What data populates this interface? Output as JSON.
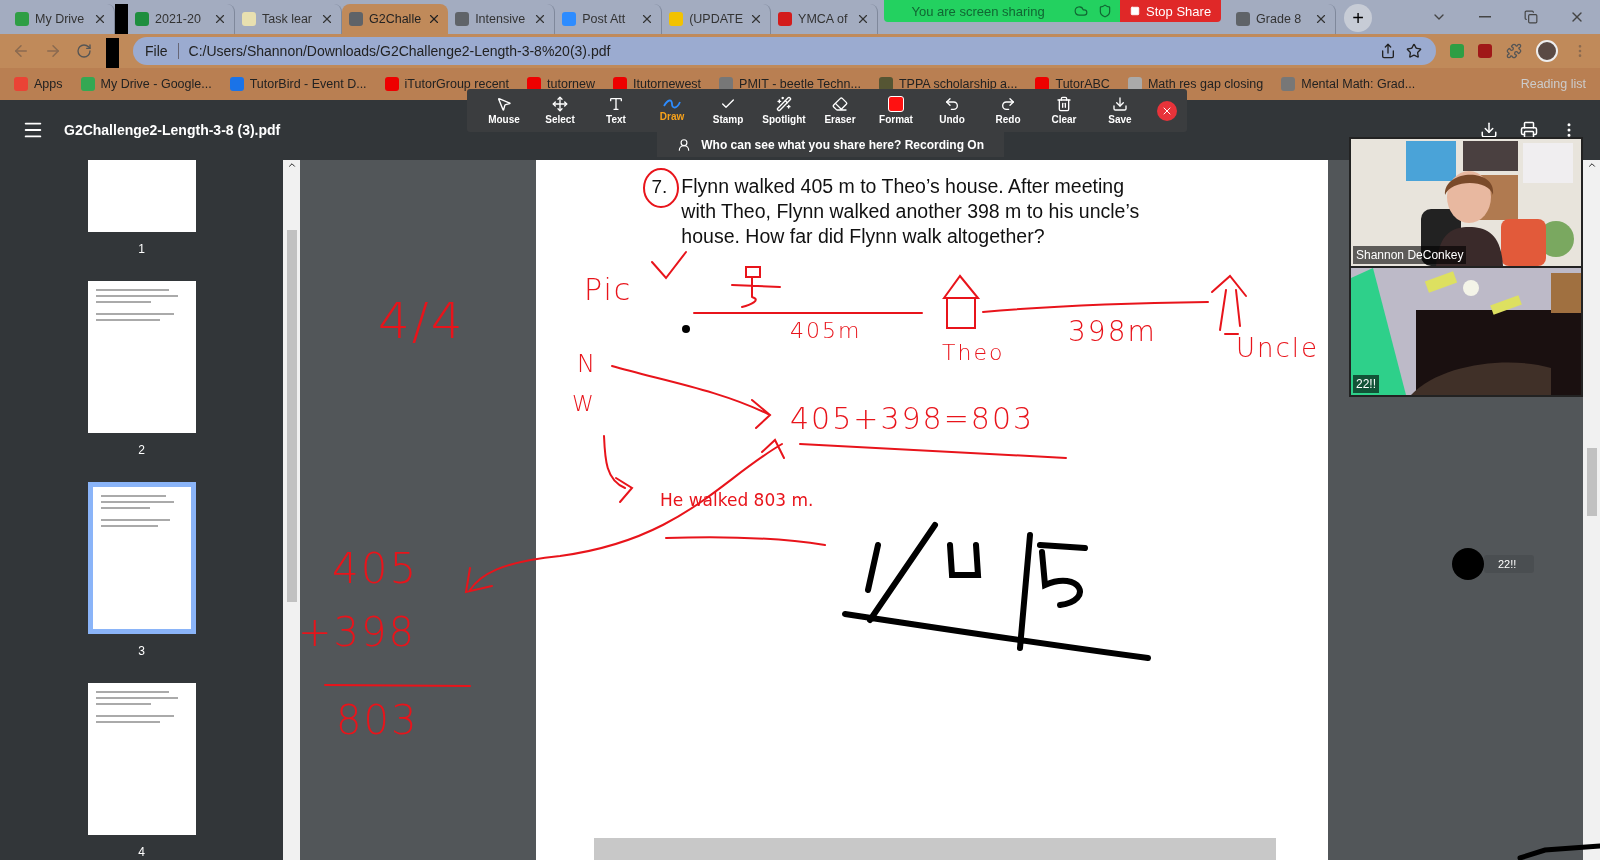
{
  "browser": {
    "tabs": [
      {
        "title": "My Drive",
        "selected": false
      },
      {
        "title": "2021-20",
        "selected": false
      },
      {
        "title": "Task lear",
        "selected": false
      },
      {
        "title": "G2Challe",
        "selected": true
      },
      {
        "title": "Intensive",
        "selected": false
      },
      {
        "title": "Post Att",
        "selected": false
      },
      {
        "title": "(UPDATE",
        "selected": false
      },
      {
        "title": "YMCA of",
        "selected": false
      },
      {
        "title": "Grade 8",
        "selected": false
      }
    ],
    "new_tab": "+",
    "sharing": {
      "label": "You are screen sharing",
      "stop": "Stop Share"
    },
    "address": {
      "scheme": "File",
      "url": "C:/Users/Shannon/Downloads/G2Challenge2-Length-3-8%20(3).pdf"
    },
    "bookmarks": [
      "Apps",
      "My Drive - Google...",
      "TutorBird - Event D...",
      "iTutorGroup recent",
      "tutornew",
      "Itutornewest",
      "PMIT - beetle Techn...",
      "TPPA scholarship a...",
      "TutorABC",
      "Math res gap closing",
      "Mental Math: Grad..."
    ],
    "reading_list": "Reading list"
  },
  "pdf": {
    "title": "G2Challenge2-Length-3-8 (3).pdf",
    "thumbnails": [
      {
        "label": "1",
        "selected": false
      },
      {
        "label": "2",
        "selected": false
      },
      {
        "label": "3",
        "selected": true
      },
      {
        "label": "4",
        "selected": false
      }
    ],
    "question": {
      "number": "7.",
      "text": "Flynn walked 405 m to Theo’s house. After meeting with Theo, Flynn walked another 398 m to his uncle’s house. How far did Flynn walk altogether?"
    },
    "answer": "He walked 803 m.",
    "ink": [
      "Pic",
      "405m",
      "Theo",
      "398m",
      "Uncle",
      "4/4",
      "N",
      "W",
      "405+398=803",
      "405",
      "+398",
      "803"
    ]
  },
  "annotate": {
    "tools": [
      {
        "kind": "mouse",
        "label": "Mouse",
        "selected": false
      },
      {
        "kind": "select",
        "label": "Select",
        "selected": false
      },
      {
        "kind": "text",
        "label": "Text",
        "selected": false
      },
      {
        "kind": "draw",
        "label": "Draw",
        "selected": true
      },
      {
        "kind": "stamp",
        "label": "Stamp",
        "selected": false
      },
      {
        "kind": "spotlight",
        "label": "Spotlight",
        "selected": false
      },
      {
        "kind": "eraser",
        "label": "Eraser",
        "selected": false
      },
      {
        "kind": "format",
        "label": "Format",
        "selected": false
      },
      {
        "kind": "undo",
        "label": "Undo",
        "selected": false
      },
      {
        "kind": "redo",
        "label": "Redo",
        "selected": false
      },
      {
        "kind": "clear",
        "label": "Clear",
        "selected": false
      },
      {
        "kind": "save",
        "label": "Save",
        "selected": false
      }
    ],
    "notice": "Who can see what you share here? Recording On"
  },
  "videos": [
    {
      "name": "Shannon DeConkey",
      "kind": "teacher"
    },
    {
      "name": "22!!",
      "kind": "room"
    }
  ],
  "floating_participant": "22!!"
}
